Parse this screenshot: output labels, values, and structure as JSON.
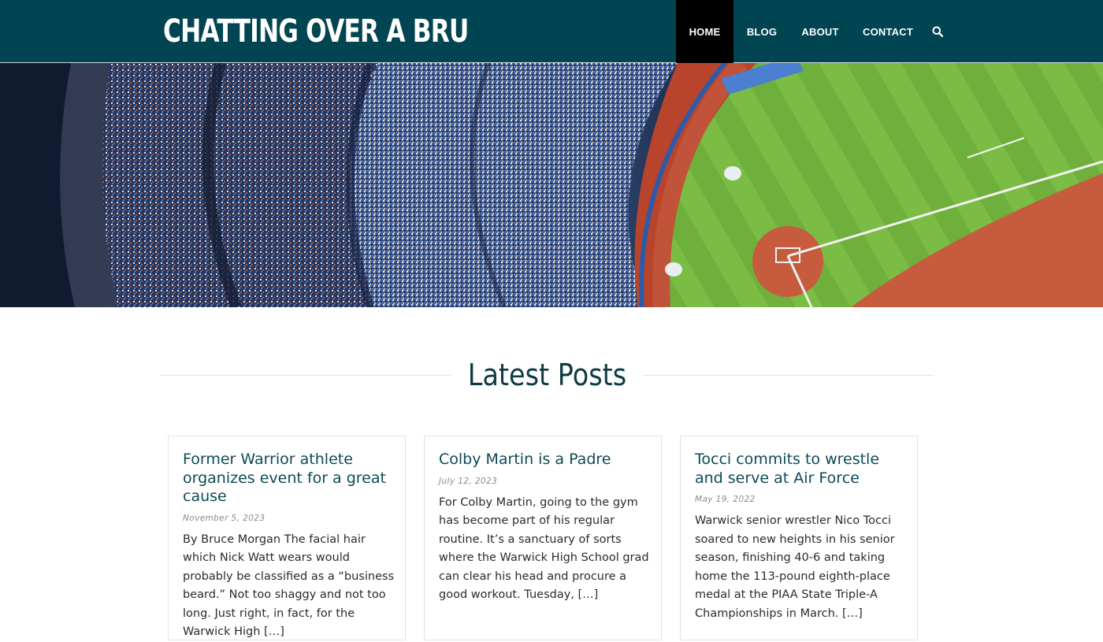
{
  "site": {
    "title": "CHATTING OVER A BRU"
  },
  "nav": {
    "items": [
      {
        "label": "HOME",
        "active": true
      },
      {
        "label": "BLOG",
        "active": false
      },
      {
        "label": "ABOUT",
        "active": false
      },
      {
        "label": "CONTACT",
        "active": false
      }
    ],
    "search_icon": "search-icon"
  },
  "hero": {
    "image": "aerial view of baseball stadium with crowd and infield"
  },
  "section": {
    "title": "Latest Posts"
  },
  "posts": [
    {
      "title": "Former Warrior athlete organizes event for a great cause",
      "date": "November 5, 2023",
      "excerpt": "By Bruce Morgan The facial hair which Nick Watt wears would probably be classified as a “business beard.” Not too shaggy and not too long. Just right, in fact, for the Warwick High […]"
    },
    {
      "title": "Colby Martin is a Padre",
      "date": "July 12, 2023",
      "excerpt": "For Colby Martin, going to the gym has become part of his regular routine. It’s a sanctuary of sorts where the Warwick High School grad can clear his head and procure a good workout. Tuesday, […]"
    },
    {
      "title": "Tocci commits to wrestle and serve at Air Force",
      "date": "May 19, 2022",
      "excerpt": "Warwick senior wrestler Nico Tocci soared to new heights in his senior season, finishing 40-6 and taking home the 113-pound eighth-place medal at the PIAA State Triple-A Championships in March. […]"
    }
  ],
  "colors": {
    "header_bg": "#004551",
    "nav_active_bg": "#000000",
    "title_color": "#0c4a57"
  }
}
